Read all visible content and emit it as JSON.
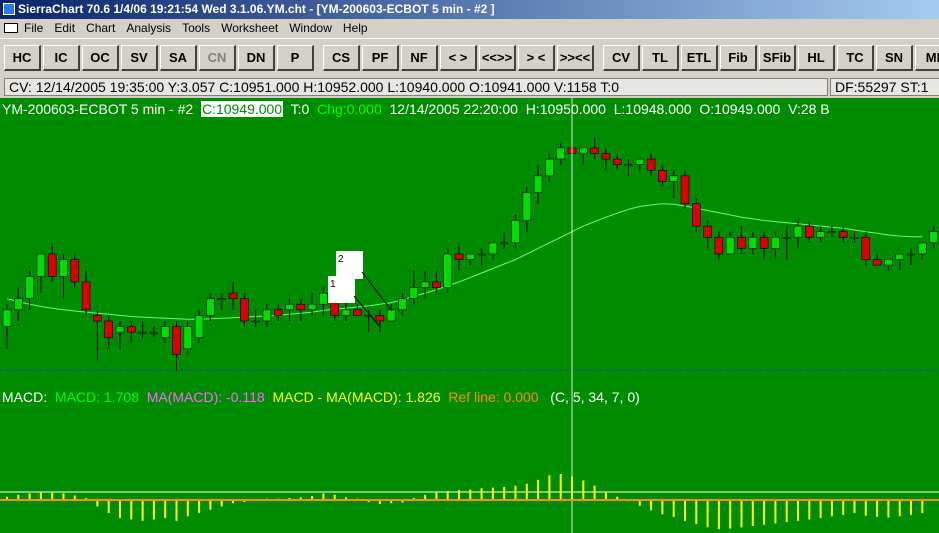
{
  "window": {
    "title": "SierraChart 70.6  1/4/06  19:21:54  Wed   3.1.06.YM.cht - [YM-200603-ECBOT  5 min - #2  ]"
  },
  "menu": [
    "File",
    "Edit",
    "Chart",
    "Analysis",
    "Tools",
    "Worksheet",
    "Window",
    "Help"
  ],
  "toolbar": [
    "HC",
    "IC",
    "OC",
    "SV",
    "SA",
    "CN",
    "DN",
    "P",
    "CS",
    "PF",
    "NF",
    "< >",
    "<<>>",
    "> <",
    ">><<",
    "CV",
    "TL",
    "ETL",
    "Fib",
    "SFib",
    "HL",
    "TC",
    "SN",
    "MI"
  ],
  "status": {
    "cursor": "CV:  12/14/2005  19:35:00  Y:3.057  C:10951.000  H:10952.000  L:10940.000  O:10941.000  V:1158  T:0",
    "df": "DF:55297  ST:1"
  },
  "chart_info": {
    "symbol": "YM-200603-ECBOT  5 min - #2",
    "close": "C:10949.000",
    "ticks": "T:0",
    "chg": "Chg:0.000",
    "datetime": "12/14/2005  22:20:00",
    "high": "H:10950.000",
    "low": "L:10948.000",
    "open": "O:10949.000",
    "volume": "V:28  B"
  },
  "macd_info": {
    "label": "MACD:",
    "macd": "MACD: 1.708",
    "ma": "MA(MACD): -0.118",
    "diff": "MACD - MA(MACD): 1.826",
    "ref": "Ref line: 0.000",
    "params": "(C, 5, 34, 7, 0)"
  },
  "annotations": [
    "2",
    "1"
  ],
  "colors": {
    "background": "#008c00",
    "up": "#00dd00",
    "down": "#dd0000",
    "ma": "#66ff66",
    "histogram": "#ffff00",
    "refline": "#ff8c00"
  },
  "chart_data": {
    "type": "candlestick",
    "bars": [
      {
        "o": 83,
        "h": 87,
        "l": 79,
        "c": 86
      },
      {
        "o": 86,
        "h": 90,
        "l": 84,
        "c": 88
      },
      {
        "o": 88,
        "h": 93,
        "l": 86,
        "c": 92
      },
      {
        "o": 92,
        "h": 96,
        "l": 89,
        "c": 96
      },
      {
        "o": 96,
        "h": 98,
        "l": 91,
        "c": 92
      },
      {
        "o": 92,
        "h": 96,
        "l": 88,
        "c": 95
      },
      {
        "o": 95,
        "h": 96,
        "l": 90,
        "c": 91
      },
      {
        "o": 91,
        "h": 93,
        "l": 85,
        "c": 86
      },
      {
        "o": 85,
        "h": 86,
        "l": 77,
        "c": 84
      },
      {
        "o": 84,
        "h": 85,
        "l": 79,
        "c": 81
      },
      {
        "o": 82,
        "h": 84,
        "l": 79,
        "c": 83
      },
      {
        "o": 83,
        "h": 84,
        "l": 80,
        "c": 82
      },
      {
        "o": 82,
        "h": 84,
        "l": 81,
        "c": 82
      },
      {
        "o": 82,
        "h": 83,
        "l": 81,
        "c": 82
      },
      {
        "o": 81,
        "h": 84,
        "l": 80,
        "c": 83
      },
      {
        "o": 83,
        "h": 84,
        "l": 75,
        "c": 78
      },
      {
        "o": 79,
        "h": 84,
        "l": 78,
        "c": 83
      },
      {
        "o": 81,
        "h": 86,
        "l": 80,
        "c": 85
      },
      {
        "o": 85,
        "h": 89,
        "l": 84,
        "c": 88
      },
      {
        "o": 88,
        "h": 89,
        "l": 86,
        "c": 88
      },
      {
        "o": 89,
        "h": 91,
        "l": 86,
        "c": 88
      },
      {
        "o": 88,
        "h": 89,
        "l": 83,
        "c": 84
      },
      {
        "o": 84,
        "h": 86,
        "l": 83,
        "c": 84
      },
      {
        "o": 84,
        "h": 87,
        "l": 83,
        "c": 86
      },
      {
        "o": 86,
        "h": 87,
        "l": 84,
        "c": 85
      },
      {
        "o": 86,
        "h": 88,
        "l": 84,
        "c": 87
      },
      {
        "o": 87,
        "h": 88,
        "l": 84,
        "c": 86
      },
      {
        "o": 86,
        "h": 89,
        "l": 85,
        "c": 87
      },
      {
        "o": 87,
        "h": 90,
        "l": 85,
        "c": 89
      },
      {
        "o": 89,
        "h": 91,
        "l": 84,
        "c": 85
      },
      {
        "o": 85,
        "h": 88,
        "l": 84,
        "c": 86
      },
      {
        "o": 86,
        "h": 87,
        "l": 85,
        "c": 85
      },
      {
        "o": 85,
        "h": 86,
        "l": 82,
        "c": 85
      },
      {
        "o": 85,
        "h": 86,
        "l": 82,
        "c": 84
      },
      {
        "o": 84,
        "h": 87,
        "l": 84,
        "c": 86
      },
      {
        "o": 86,
        "h": 89,
        "l": 85,
        "c": 88
      },
      {
        "o": 88,
        "h": 93,
        "l": 87,
        "c": 90
      },
      {
        "o": 90,
        "h": 93,
        "l": 88,
        "c": 91
      },
      {
        "o": 91,
        "h": 93,
        "l": 89,
        "c": 90
      },
      {
        "o": 90,
        "h": 97,
        "l": 89,
        "c": 96
      },
      {
        "o": 96,
        "h": 98,
        "l": 93,
        "c": 95
      },
      {
        "o": 95,
        "h": 96,
        "l": 94,
        "c": 96
      },
      {
        "o": 96,
        "h": 97,
        "l": 94,
        "c": 96
      },
      {
        "o": 96,
        "h": 98,
        "l": 95,
        "c": 98
      },
      {
        "o": 98,
        "h": 100,
        "l": 97,
        "c": 98
      },
      {
        "o": 98,
        "h": 103,
        "l": 97,
        "c": 102
      },
      {
        "o": 102,
        "h": 108,
        "l": 100,
        "c": 107
      },
      {
        "o": 107,
        "h": 112,
        "l": 105,
        "c": 110
      },
      {
        "o": 110,
        "h": 114,
        "l": 109,
        "c": 113
      },
      {
        "o": 113,
        "h": 116,
        "l": 112,
        "c": 115
      },
      {
        "o": 115,
        "h": 116,
        "l": 113,
        "c": 114
      },
      {
        "o": 114,
        "h": 115,
        "l": 112,
        "c": 115
      },
      {
        "o": 115,
        "h": 117,
        "l": 113,
        "c": 114
      },
      {
        "o": 114,
        "h": 115,
        "l": 111,
        "c": 113
      },
      {
        "o": 113,
        "h": 114,
        "l": 111,
        "c": 112
      },
      {
        "o": 112,
        "h": 113,
        "l": 110,
        "c": 112
      },
      {
        "o": 112,
        "h": 113,
        "l": 111,
        "c": 113
      },
      {
        "o": 113,
        "h": 114,
        "l": 110,
        "c": 111
      },
      {
        "o": 111,
        "h": 112,
        "l": 108,
        "c": 109
      },
      {
        "o": 109,
        "h": 111,
        "l": 106,
        "c": 110
      },
      {
        "o": 110,
        "h": 111,
        "l": 104,
        "c": 105
      },
      {
        "o": 105,
        "h": 106,
        "l": 100,
        "c": 101
      },
      {
        "o": 101,
        "h": 102,
        "l": 97,
        "c": 99
      },
      {
        "o": 99,
        "h": 100,
        "l": 95,
        "c": 96
      },
      {
        "o": 96,
        "h": 100,
        "l": 96,
        "c": 99
      },
      {
        "o": 99,
        "h": 101,
        "l": 96,
        "c": 97
      },
      {
        "o": 97,
        "h": 100,
        "l": 96,
        "c": 99
      },
      {
        "o": 99,
        "h": 100,
        "l": 95,
        "c": 97
      },
      {
        "o": 97,
        "h": 100,
        "l": 95,
        "c": 99
      },
      {
        "o": 99,
        "h": 101,
        "l": 95,
        "c": 99
      },
      {
        "o": 99,
        "h": 102,
        "l": 97,
        "c": 101
      },
      {
        "o": 101,
        "h": 102,
        "l": 98,
        "c": 99
      },
      {
        "o": 99,
        "h": 101,
        "l": 98,
        "c": 100
      },
      {
        "o": 100,
        "h": 101,
        "l": 99,
        "c": 100
      },
      {
        "o": 100,
        "h": 101,
        "l": 98,
        "c": 99
      },
      {
        "o": 99,
        "h": 100,
        "l": 98,
        "c": 99
      },
      {
        "o": 99,
        "h": 100,
        "l": 94,
        "c": 95
      },
      {
        "o": 95,
        "h": 96,
        "l": 94,
        "c": 94
      },
      {
        "o": 94,
        "h": 95,
        "l": 93,
        "c": 95
      },
      {
        "o": 95,
        "h": 96,
        "l": 93,
        "c": 96
      },
      {
        "o": 96,
        "h": 97,
        "l": 94,
        "c": 96
      },
      {
        "o": 96,
        "h": 98,
        "l": 95,
        "c": 98
      },
      {
        "o": 98,
        "h": 101,
        "l": 97,
        "c": 100
      }
    ],
    "ma": [
      88,
      87.5,
      87,
      86.6,
      86.3,
      86,
      85.8,
      85.6,
      85.4,
      85.2,
      85,
      84.8,
      84.7,
      84.6,
      84.5,
      84.4,
      84.3,
      84.3,
      84.4,
      84.5,
      84.6,
      84.7,
      84.8,
      84.9,
      85,
      85.2,
      85.4,
      85.6,
      85.9,
      86.1,
      86.3,
      86.5,
      86.7,
      87,
      87.3,
      87.8,
      88.4,
      89,
      89.6,
      90.3,
      91,
      91.8,
      92.6,
      93.4,
      94.2,
      95,
      96,
      97,
      98,
      99,
      100,
      101,
      101.8,
      102.6,
      103.3,
      104,
      104.5,
      104.8,
      105,
      104.9,
      104.6,
      104.2,
      103.8,
      103.4,
      103,
      102.6,
      102.3,
      102,
      101.8,
      101.6,
      101.4,
      101.2,
      101,
      100.8,
      100.6,
      100.3,
      100,
      99.7,
      99.4,
      99.2,
      99.1,
      99.1
    ],
    "histogram": [
      0.5,
      0.8,
      1.0,
      1.3,
      1.1,
      1.0,
      0.7,
      0.3,
      -1.0,
      -2.0,
      -2.8,
      -3.0,
      -3.2,
      -3.0,
      -2.8,
      -3.2,
      -2.5,
      -2.0,
      -1.5,
      -1.0,
      -0.5,
      -0.3,
      0.1,
      0.2,
      0.2,
      0.3,
      0.4,
      0.6,
      1.0,
      0.8,
      0.4,
      0.2,
      -0.3,
      -0.6,
      -0.5,
      -0.4,
      0.3,
      0.8,
      1.2,
      1.4,
      1.5,
      1.6,
      1.8,
      1.9,
      2.0,
      2.2,
      2.5,
      3.1,
      3.8,
      4.0,
      3.6,
      3.0,
      2.2,
      1.3,
      0.5,
      -0.2,
      -0.9,
      -1.6,
      -2.2,
      -2.6,
      -3.2,
      -3.7,
      -4.2,
      -4.5,
      -4.4,
      -4.2,
      -4.0,
      -3.8,
      -3.6,
      -3.4,
      -3.2,
      -3.0,
      -2.8,
      -2.5,
      -2.3,
      -2.0,
      -2.4,
      -2.6,
      -2.7,
      -2.5,
      -2.3,
      -2.0
    ],
    "cursor_bar_index": 50,
    "ylim": [
      72,
      120
    ],
    "macd_ylim": [
      -5,
      5
    ]
  }
}
